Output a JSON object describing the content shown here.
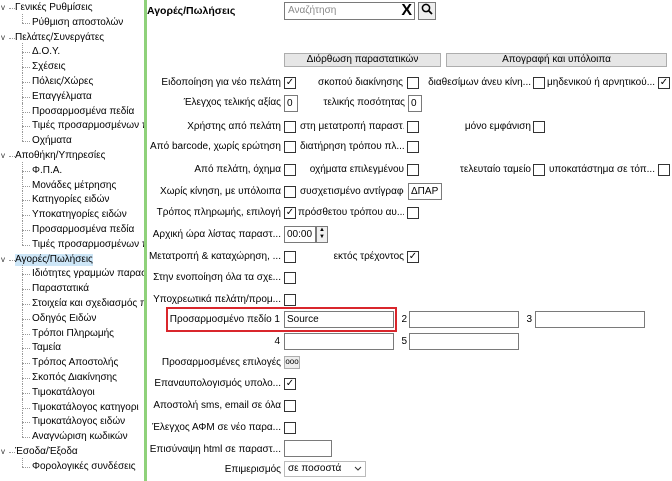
{
  "tree": [
    {
      "label": "Γενικές Ρυθμίσεις",
      "level": 0,
      "toggle": "v"
    },
    {
      "label": "Ρύθμιση αποστολών",
      "level": 1
    },
    {
      "label": "Πελάτες/Συνεργάτες",
      "level": 0,
      "toggle": "v"
    },
    {
      "label": "Δ.Ο.Υ.",
      "level": 1
    },
    {
      "label": "Σχέσεις",
      "level": 1
    },
    {
      "label": "Πόλεις/Χώρες",
      "level": 1
    },
    {
      "label": "Επαγγέλματα",
      "level": 1
    },
    {
      "label": "Προσαρμοσμένα πεδία",
      "level": 1
    },
    {
      "label": "Τιμές προσαρμοσμένων π",
      "level": 1
    },
    {
      "label": "Οχήματα",
      "level": 1
    },
    {
      "label": "Αποθήκη/Υπηρεσίες",
      "level": 0,
      "toggle": "v"
    },
    {
      "label": "Φ.Π.Α.",
      "level": 1
    },
    {
      "label": "Μονάδες μέτρησης",
      "level": 1
    },
    {
      "label": "Κατηγορίες ειδών",
      "level": 1
    },
    {
      "label": "Υποκατηγορίες ειδών",
      "level": 1
    },
    {
      "label": "Προσαρμοσμένα πεδία",
      "level": 1
    },
    {
      "label": "Τιμές προσαρμοσμένων π",
      "level": 1
    },
    {
      "label": "Αγορές/Πωλήσεις",
      "level": 0,
      "toggle": "v",
      "selected": true
    },
    {
      "label": "Ιδιότητες γραμμών παραστ",
      "level": 1
    },
    {
      "label": "Παραστατικά",
      "level": 1
    },
    {
      "label": "Στοιχεία και σχεδιασμός π",
      "level": 1
    },
    {
      "label": "Οδηγός Ειδών",
      "level": 1
    },
    {
      "label": "Τρόποι Πληρωμής",
      "level": 1
    },
    {
      "label": "Ταμεία",
      "level": 1
    },
    {
      "label": "Τρόπος Αποστολής",
      "level": 1
    },
    {
      "label": "Σκοπός Διακίνησης",
      "level": 1
    },
    {
      "label": "Τιμοκατάλογοι",
      "level": 1
    },
    {
      "label": "Τιμοκατάλογος κατηγορι",
      "level": 1
    },
    {
      "label": "Τιμοκατάλογος ειδών",
      "level": 1
    },
    {
      "label": "Αναγνώριση κωδικών",
      "level": 1
    },
    {
      "label": "Έσοδα/Έξοδα",
      "level": 0,
      "toggle": "v"
    },
    {
      "label": "Φορολογικές συνδέσεις",
      "level": 1
    }
  ],
  "header": {
    "title": "Αγορές/Πωλήσεις",
    "search_placeholder": "Αναζήτηση",
    "clear_glyph": "X",
    "search_glyph": "🔍"
  },
  "buttons": {
    "doc_fix": "Διόρθωση παραστατικών",
    "inventory": "Απογραφή και υπόλοιπα"
  },
  "form": {
    "r1_label": "Ειδοποίηση για νέο πελάτη",
    "r1_c2": "σκοπού διακίνησης",
    "r1_c3": "διαθεσίμων άνευ κίνη...",
    "r1_c4": "μηδενικού ή αρνητικού...",
    "r2_label": "Έλεγχος τελικής αξίας",
    "r2_value": "0",
    "r2_c2": "τελικής ποσότητας",
    "r2_value2": "0",
    "r3_label": "Χρήστης από πελάτη",
    "r3_c2": "στη μετατροπή παραστ.",
    "r3_c3": "μόνο εμφάνιση",
    "r4_label": "Από barcode, χωρίς ερώτηση",
    "r4_c2": "διατήρηση τρόπου πλ...",
    "r5_label": "Από πελάτη, όχημα",
    "r5_c2": "οχήματα επιλεγμένου",
    "r5_c3": "τελευταίο ταμείο",
    "r5_c4": "υποκατάστημα σε τόπ...",
    "r6_label": "Χωρίς κίνηση, με υπόλοιπα",
    "r6_c2": "συσχετισμένο αντίγραφο",
    "r6_value": "ΔΠΑΡ",
    "r7_label": "Τρόπος πληρωμής, επιλογή",
    "r7_c2": "πρόσθετου τρόπου αυ...",
    "r8_label": "Αρχική ώρα λίστας παραστ...",
    "r8_value": "00:00",
    "r9_label": "Μετατροπή & καταχώρηση, ...",
    "r9_c2": "εκτός τρέχοντος",
    "r10_label": "Στην ενοποίηση όλα τα σχε...",
    "r11_label": "Υποχρεωτικά πελάτη/προμ...",
    "r12_label": "Προσαρμοσμένο πεδίο 1",
    "r12_value": "Source",
    "num2": "2",
    "num3": "3",
    "num4": "4",
    "num5": "5",
    "r13_label": "Προσαρμοσμένες επιλογές",
    "r13_btn": "ooo",
    "r14_label": "Επαναυπολογισμός υπολο...",
    "r15_label": "Αποστολή sms, email σε όλα",
    "r16_label": "Έλεγχος ΑΦΜ σε νέο παρα...",
    "r17_label": "Επισύναψη html σε παραστ...",
    "r18_label": "Επιμερισμός",
    "r18_value": "σε ποσοστά",
    "check": "✓"
  },
  "checks": {
    "r1": true,
    "r1_c2": false,
    "r1_c3": false,
    "r1_c4": true,
    "r3": false,
    "r3_c2": false,
    "r3_c3": false,
    "r4": false,
    "r4_c2": false,
    "r5": false,
    "r5_c2": false,
    "r5_c3": false,
    "r5_c4": false,
    "r6": false,
    "r7": true,
    "r7_c2": false,
    "r9": false,
    "r9_c2": true,
    "r10": false,
    "r11": false,
    "r14": true,
    "r15": false,
    "r16": false
  },
  "colors": {
    "accent_border": "#8fd17a",
    "highlight": "#d9262c"
  }
}
